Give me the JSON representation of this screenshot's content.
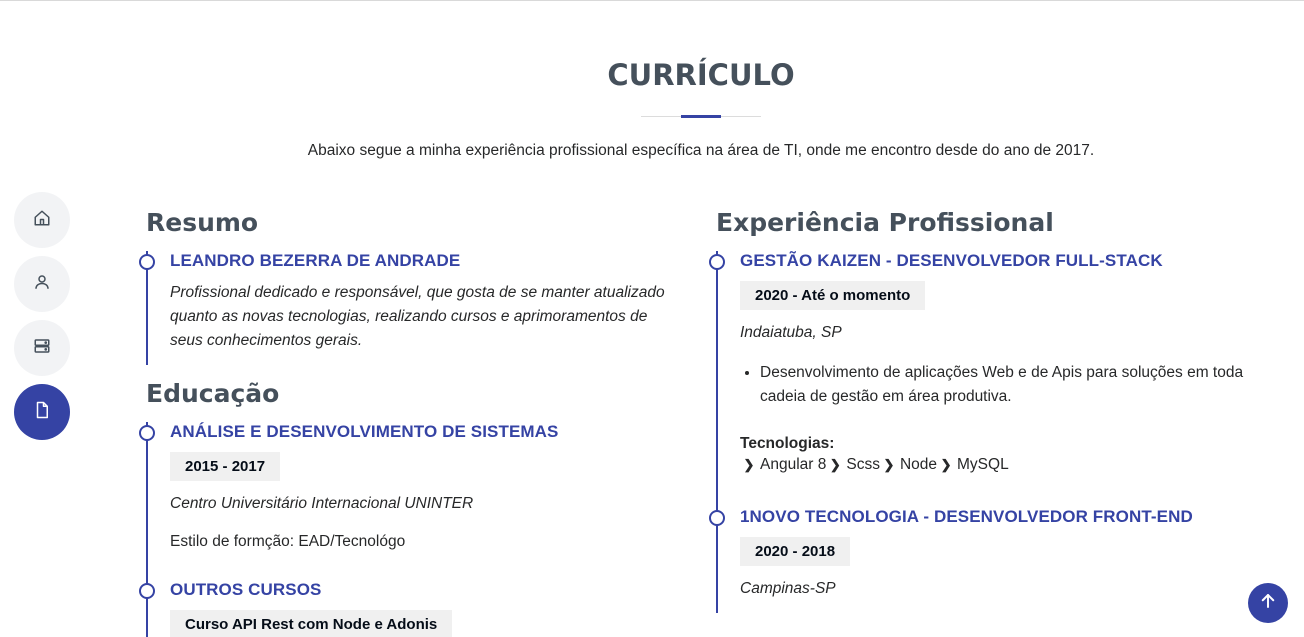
{
  "section": {
    "title": "CURRÍCULO",
    "intro": "Abaixo segue a minha experiência profissional específica na área de TI, onde me encontro desde do ano de 2017."
  },
  "nav": {
    "items": [
      {
        "icon": "home-icon"
      },
      {
        "icon": "user-icon"
      },
      {
        "icon": "server-icon"
      },
      {
        "icon": "file-icon"
      }
    ]
  },
  "resumo": {
    "title": "Resumo",
    "name": "LEANDRO BEZERRA DE ANDRADE",
    "description": "Profissional dedicado e responsável, que gosta de se manter atualizado quanto as novas tecnologias, realizando cursos e aprimoramentos de seus conhecimentos gerais."
  },
  "educacao": {
    "title": "Educação",
    "items": [
      {
        "title": "ANÁLISE E DESENVOLVIMENTO DE SISTEMAS",
        "period": "2015 - 2017",
        "institution": "Centro Universitário Internacional UNINTER",
        "details": "Estilo de formção: EAD/Tecnológo"
      },
      {
        "title": "OUTROS CURSOS",
        "period": "Curso API Rest com Node e Adonis"
      }
    ]
  },
  "experiencia": {
    "title": "Experiência Profissional",
    "items": [
      {
        "title": "GESTÃO KAIZEN - DESENVOLVEDOR FULL-STACK",
        "period": "2020 - Até o momento",
        "location": "Indaiatuba, SP",
        "bullet": "Desenvolvimento de aplicações Web e de Apis para soluções em toda cadeia de gestão em área produtiva.",
        "tech_label": "Tecnologias:",
        "tech": [
          "Angular 8",
          "Scss",
          "Node",
          "MySQL"
        ]
      },
      {
        "title": "1NOVO TECNOLOGIA - DESENVOLVEDOR FRONT-END",
        "period": "2020 - 2018",
        "location": "Campinas-SP"
      }
    ]
  },
  "colors": {
    "accent": "#3543a4",
    "heading": "#45505b",
    "badge_bg": "#f0f0f0",
    "nav_bg": "#f2f3f5"
  }
}
